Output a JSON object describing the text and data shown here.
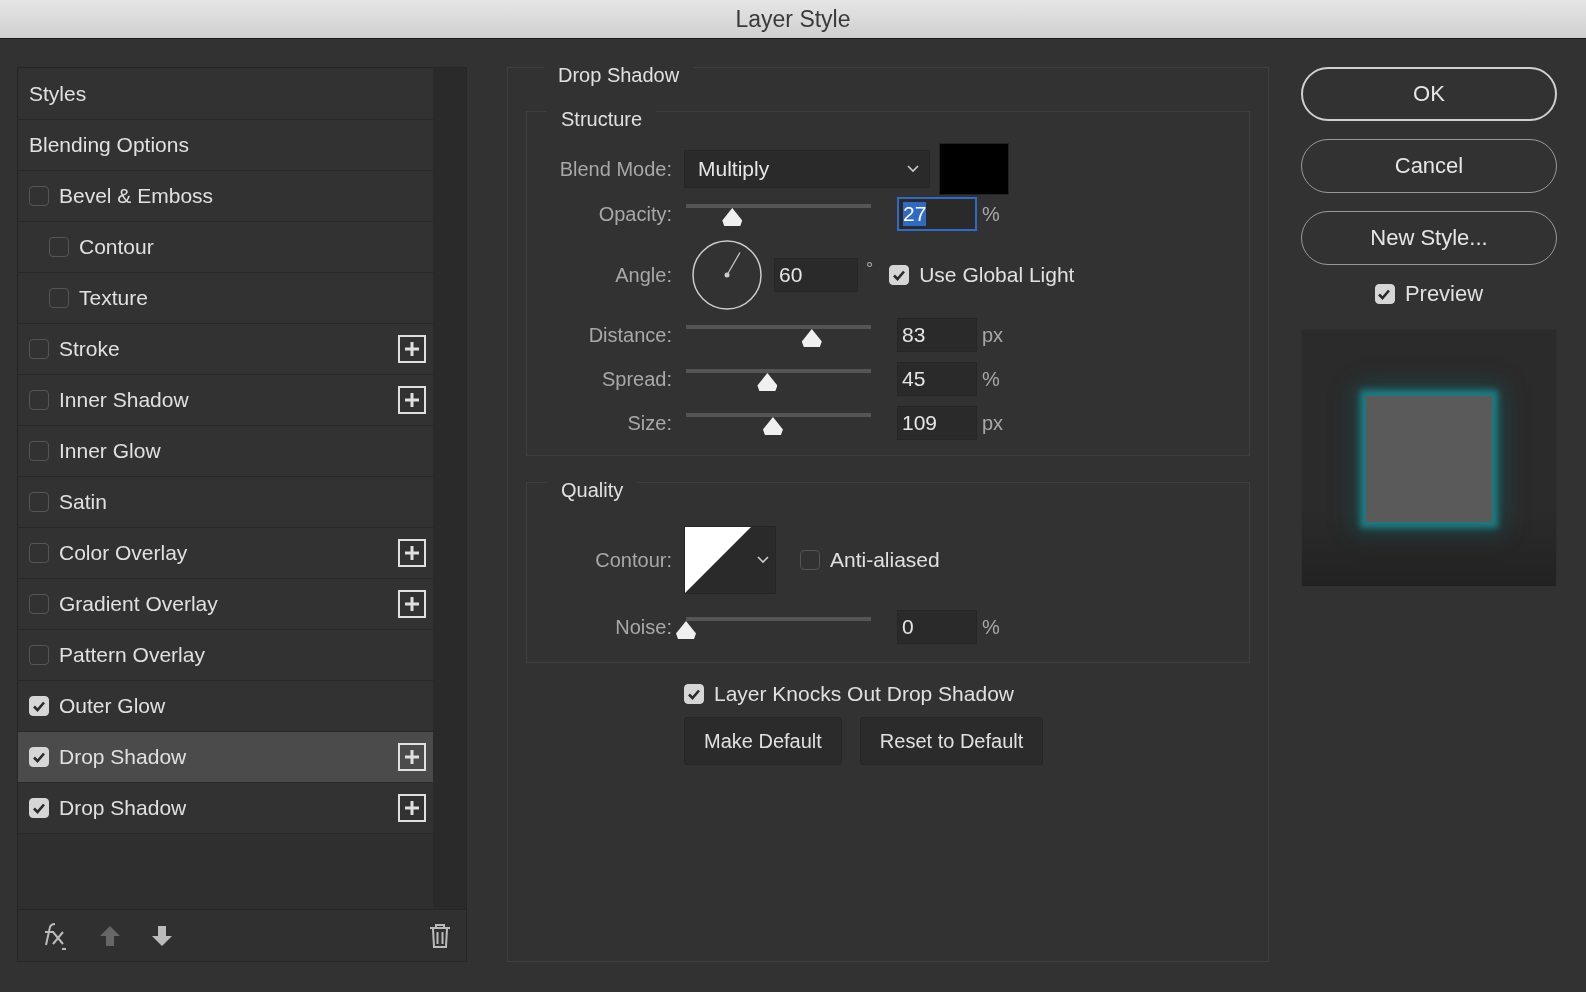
{
  "window": {
    "title": "Layer Style"
  },
  "styles_list": {
    "items": [
      {
        "kind": "header",
        "label": "Styles",
        "selected": false
      },
      {
        "kind": "header",
        "label": "Blending Options",
        "selected": false
      },
      {
        "kind": "effect",
        "label": "Bevel & Emboss",
        "checked": false,
        "selected": false,
        "addable": false,
        "children": [
          {
            "kind": "effect",
            "label": "Contour",
            "checked": false,
            "selected": false,
            "addable": false
          },
          {
            "kind": "effect",
            "label": "Texture",
            "checked": false,
            "selected": false,
            "addable": false
          }
        ]
      },
      {
        "kind": "effect",
        "label": "Stroke",
        "checked": false,
        "selected": false,
        "addable": true
      },
      {
        "kind": "effect",
        "label": "Inner Shadow",
        "checked": false,
        "selected": false,
        "addable": true
      },
      {
        "kind": "effect",
        "label": "Inner Glow",
        "checked": false,
        "selected": false,
        "addable": false
      },
      {
        "kind": "effect",
        "label": "Satin",
        "checked": false,
        "selected": false,
        "addable": false
      },
      {
        "kind": "effect",
        "label": "Color Overlay",
        "checked": false,
        "selected": false,
        "addable": true
      },
      {
        "kind": "effect",
        "label": "Gradient Overlay",
        "checked": false,
        "selected": false,
        "addable": true
      },
      {
        "kind": "effect",
        "label": "Pattern Overlay",
        "checked": false,
        "selected": false,
        "addable": false
      },
      {
        "kind": "effect",
        "label": "Outer Glow",
        "checked": true,
        "selected": false,
        "addable": false
      },
      {
        "kind": "effect",
        "label": "Drop Shadow",
        "checked": true,
        "selected": true,
        "addable": true
      },
      {
        "kind": "effect",
        "label": "Drop Shadow",
        "checked": true,
        "selected": false,
        "addable": true
      }
    ]
  },
  "settings": {
    "title": "Drop Shadow",
    "structure": {
      "title": "Structure",
      "blend_mode": {
        "label": "Blend Mode:",
        "value": "Multiply",
        "color": "#000000"
      },
      "opacity": {
        "label": "Opacity:",
        "level": 0.25,
        "value": "27",
        "unit": "%",
        "focused": true
      },
      "angle": {
        "label": "Angle:",
        "value": "60",
        "unit": "°",
        "use_global_light": {
          "label": "Use Global Light",
          "checked": true
        }
      },
      "sliders": [
        {
          "label": "Distance:",
          "level": 0.68,
          "value": "83",
          "unit": "px"
        },
        {
          "label": "Spread:",
          "level": 0.44,
          "value": "45",
          "unit": "%"
        },
        {
          "label": "Size:",
          "level": 0.47,
          "value": "109",
          "unit": "px"
        }
      ]
    },
    "quality": {
      "title": "Quality",
      "contour": {
        "label": "Contour:"
      },
      "anti_aliased": {
        "label": "Anti-aliased",
        "checked": false
      },
      "noise": {
        "label": "Noise:",
        "level": 0,
        "value": "0",
        "unit": "%"
      }
    },
    "knockout": {
      "label": "Layer Knocks Out Drop Shadow",
      "checked": true
    },
    "buttons": [
      "Make Default",
      "Reset to Default"
    ]
  },
  "actions": {
    "buttons": [
      {
        "label": "OK",
        "default": true
      },
      {
        "label": "Cancel",
        "default": false
      },
      {
        "label": "New Style...",
        "default": false
      }
    ],
    "preview": {
      "label": "Preview",
      "checked": true
    }
  }
}
